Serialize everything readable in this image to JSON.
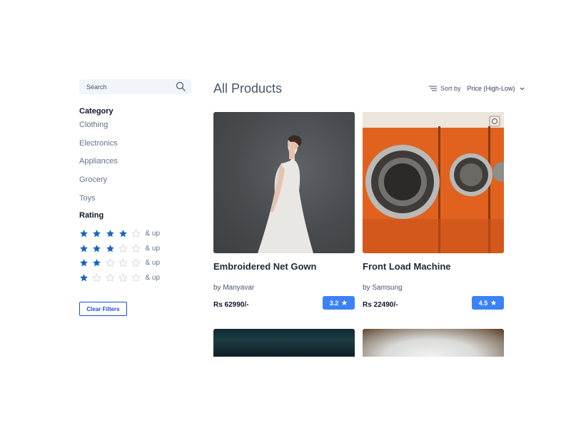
{
  "search": {
    "placeholder": "Search"
  },
  "filters": {
    "category_title": "Category",
    "categories": [
      "Clothing",
      "Electronics",
      "Appliances",
      "Grocery",
      "Toys"
    ],
    "rating_title": "Rating",
    "ratings": [
      {
        "stars": 4,
        "label": "& up"
      },
      {
        "stars": 3,
        "label": "& up"
      },
      {
        "stars": 2,
        "label": "& up"
      },
      {
        "stars": 1,
        "label": "& up"
      }
    ],
    "clear_label": "Clear Filters"
  },
  "main": {
    "title": "All Products",
    "sort_label": "Sort by",
    "sort_value": "Price (High-Low)"
  },
  "products": [
    {
      "name": "Embroidered Net Gown",
      "brand": "by Manyavar",
      "price": "Rs 62990/-",
      "rating": "3.2"
    },
    {
      "name": "Front Load Machine",
      "brand": "by Samsung",
      "price": "Rs 22490/-",
      "rating": "4.5"
    }
  ],
  "colors": {
    "accent": "#3b82f6",
    "star_filled": "#1565c0",
    "star_empty": "#d1d5db",
    "button_border": "#1d4ed8"
  }
}
